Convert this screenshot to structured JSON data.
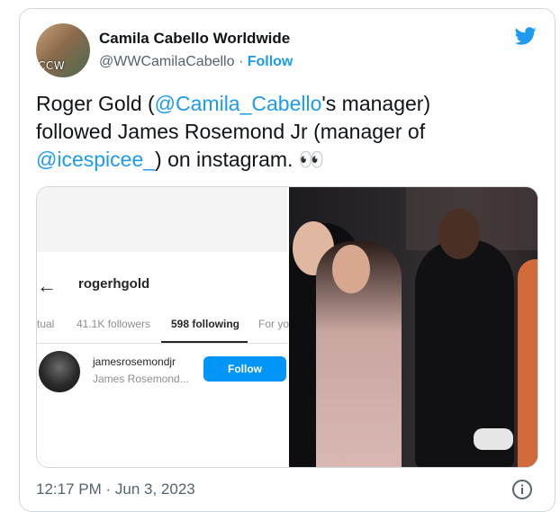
{
  "author": {
    "display_name": "Camila Cabello Worldwide",
    "handle": "@WWCamilaCabello",
    "separator": " · ",
    "follow_label": "Follow",
    "avatar_text": "CCW"
  },
  "tweet": {
    "text_1": "Roger Gold (",
    "mention_1": "@Camila_Cabello",
    "text_2": "'s manager) followed James Rosemond Jr (manager of ",
    "mention_2": "@icespicee_",
    "text_3": ") on instagram. 👀",
    "timestamp": "12:17 PM · Jun 3, 2023"
  },
  "instagram": {
    "back_arrow": "←",
    "username": "rogerhgold",
    "tabs": [
      "tual",
      "41.1K followers",
      "598 following",
      "For yo"
    ],
    "active_tab": "598 following",
    "following_item": {
      "username": "jamesrosemondjr",
      "name": "James Rosemond...",
      "button_label": "Follow"
    }
  },
  "icons": {
    "brand": "twitter-bird-icon",
    "info": "info-icon"
  },
  "colors": {
    "accent": "#1d9bf0",
    "ig_button": "#0095f6",
    "muted": "#536471"
  }
}
